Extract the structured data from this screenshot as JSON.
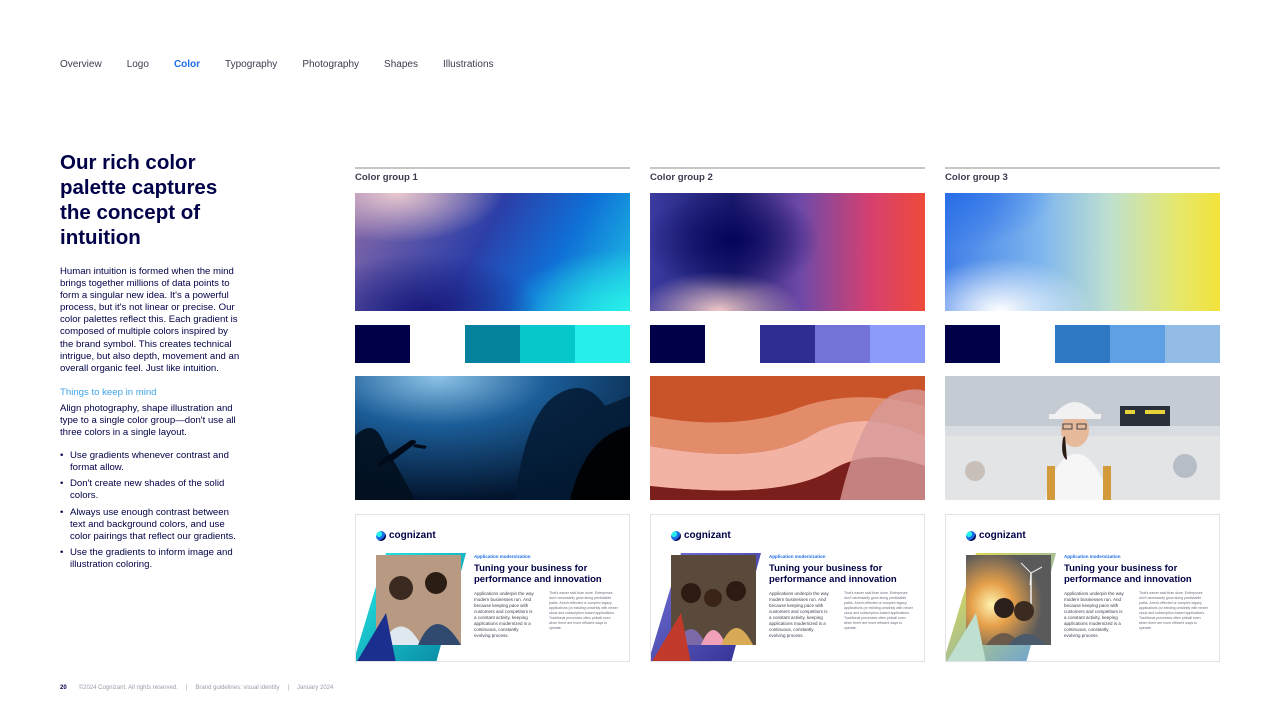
{
  "nav": {
    "items": [
      "Overview",
      "Logo",
      "Color",
      "Typography",
      "Photography",
      "Shapes",
      "Illustrations"
    ],
    "active": "Color"
  },
  "left": {
    "headline": "Our rich color palette captures the concept of intuition",
    "body": "Human intuition is formed when the mind brings together millions of data points to form a singular new idea. It's a powerful process, but it's not linear or precise. Our color palettes reflect this. Each gradient is composed of multiple colors inspired by the brand symbol. This creates technical intrigue, but also depth, movement and an overall organic feel. Just like intuition.",
    "keep_title": "Things to keep in mind",
    "keep_text": "Align photography, shape illustration and type to a single color group—don't use all three colors in a single layout.",
    "bullets": [
      "Use gradients whenever contrast and format allow.",
      "Don't create new shades of the solid colors.",
      "Always use enough contrast between text and background colors, and use color pairings that reflect our gradients.",
      "Use the gradients to inform image and illustration coloring."
    ]
  },
  "groups": [
    {
      "title": "Color group 1",
      "swatches": [
        "#000048",
        "#ffffff",
        "#06819e",
        "#06c7cc",
        "#26efe9"
      ],
      "card": {
        "logo": "cognizant",
        "eyebrow": "Application modernization",
        "title": "Tuning your business for performance and innovation",
        "col1": "Applications underpin the way modern businesses run. And because keeping pace with customers and competitors is a constant activity, keeping applications modernized is a continuous, constantly evolving process.",
        "col2": "That's easier said than done. Enterprises don't necessarily grow along predictable paths. A tech-effected or complex legacy applications (or existing unwieldy with newer cloud and subscription-based applications. Traditional processes often pinball even when there are more efficient ways to operate."
      }
    },
    {
      "title": "Color group 2",
      "swatches": [
        "#000048",
        "#ffffff",
        "#2f2d8f",
        "#7373d8",
        "#8c9bf7"
      ],
      "card": {
        "logo": "cognizant",
        "eyebrow": "Application modernization",
        "title": "Tuning your business for performance and innovation",
        "col1": "Applications underpin the way modern businesses run. And because keeping pace with customers and competitors is a constant activity, keeping applications modernized is a continuous, constantly evolving process.",
        "col2": "That's easier said than done. Enterprises don't necessarily grow along predictable paths. A tech-effected or complex legacy applications (or existing unwieldy with newer cloud and subscription-based applications. Traditional processes often pinball even when there are more efficient ways to operate."
      }
    },
    {
      "title": "Color group 3",
      "swatches": [
        "#000048",
        "#ffffff",
        "#2f78c4",
        "#5f9fe4",
        "#92bbe6"
      ],
      "card": {
        "logo": "cognizant",
        "eyebrow": "Application modernization",
        "title": "Tuning your business for performance and innovation",
        "col1": "Applications underpin the way modern businesses run. And because keeping pace with customers and competitors is a constant activity, keeping applications modernized is a continuous, constantly evolving process.",
        "col2": "That's easier said than done. Enterprises don't necessarily grow along predictable paths. A tech-effected or complex legacy applications (or existing unwieldy with newer cloud and subscription-based applications. Traditional processes often pinball even when there are more efficient ways to operate."
      }
    }
  ],
  "footer": {
    "page": "20",
    "copyright": "©2024 Cognizant. All rights reserved.",
    "sep1": "|",
    "doc": "Brand guidelines: visual identity",
    "sep2": "|",
    "date": "January 2024"
  },
  "colors": {
    "navy": "#000048",
    "accent_blue": "#1b6ee6",
    "light_blue": "#3fa3e6"
  },
  "icons": [
    "cognizant-logo-mark"
  ]
}
